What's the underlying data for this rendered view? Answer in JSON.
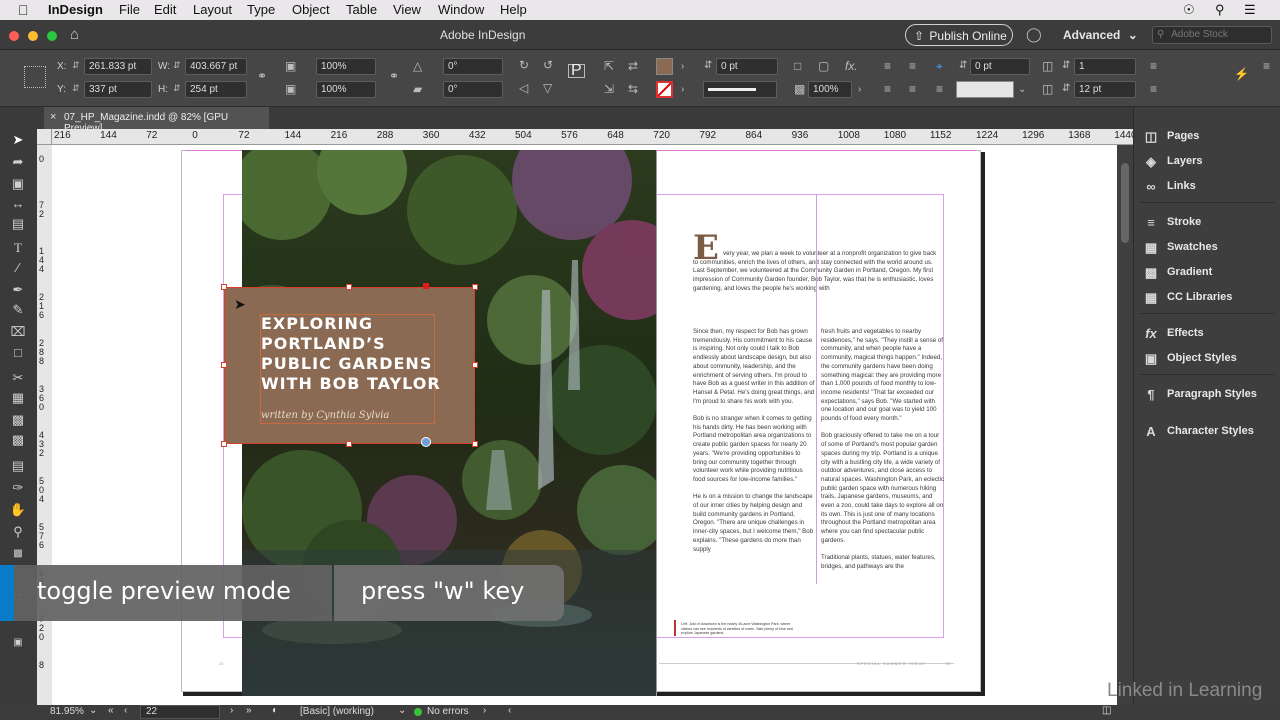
{
  "menubar": {
    "items": [
      "InDesign",
      "File",
      "Edit",
      "Layout",
      "Type",
      "Object",
      "Table",
      "View",
      "Window",
      "Help"
    ]
  },
  "titlebar": {
    "title": "Adobe InDesign",
    "publish_label": "Publish Online",
    "workspace": "Advanced",
    "search_placeholder": "Adobe Stock"
  },
  "control": {
    "x": "261.833 pt",
    "y": "337 pt",
    "w": "403.667 pt",
    "h": "254 pt",
    "x_label": "X:",
    "y_label": "Y:",
    "w_label": "W:",
    "h_label": "H:",
    "scale_x": "100%",
    "scale_y": "100%",
    "rotate": "0°",
    "shear": "0°",
    "stroke_weight": "0 pt",
    "opacity": "100%",
    "offset": "0 pt",
    "columns": "1",
    "gutter": "12 pt",
    "fill_color": "#8b6a54"
  },
  "tab": {
    "title": "07_HP_Magazine.indd @ 82% [GPU Preview]"
  },
  "hruler": [
    "216",
    "144",
    "72",
    "0",
    "72",
    "144",
    "216",
    "288",
    "360",
    "432",
    "504",
    "576",
    "648",
    "720",
    "792",
    "864",
    "936",
    "1008",
    "1080",
    "1152",
    "1224",
    "1296",
    "1368",
    "1440"
  ],
  "vruler": [
    "0",
    "7 2",
    "1 4 4",
    "2 1 6",
    "2 8 8",
    "3 6 0",
    "4 3 2",
    "5 0 4",
    "5 7 6",
    "6 4 8",
    "7 2 0",
    "8"
  ],
  "panels": [
    {
      "label": "Pages",
      "icon": "pages-icon"
    },
    {
      "label": "Layers",
      "icon": "layers-icon"
    },
    {
      "label": "Links",
      "icon": "links-icon"
    },
    {
      "label": "Stroke",
      "icon": "stroke-icon"
    },
    {
      "label": "Swatches",
      "icon": "swatches-icon"
    },
    {
      "label": "Gradient",
      "icon": "gradient-icon"
    },
    {
      "label": "CC Libraries",
      "icon": "cc-libraries-icon"
    },
    {
      "label": "Effects",
      "icon": "effects-icon"
    },
    {
      "label": "Object Styles",
      "icon": "object-styles-icon"
    },
    {
      "label": "Paragraph Styles",
      "icon": "paragraph-styles-icon"
    },
    {
      "label": "Character Styles",
      "icon": "character-styles-icon"
    }
  ],
  "article": {
    "headline": [
      "EXPLORING",
      "PORTLAND’S",
      "PUBLIC GARDENS",
      "WITH BOB TAYLOR"
    ],
    "byline": "written by Cynthia Sylvia",
    "dropcap": "E",
    "intro": "very year, we plan a week to volunteer at a nonprofit organization to give back to communities, enrich the lives of others, and stay connected with the world around us. Last September, we volunteered at the Community Garden in Portland, Oregon. My first impression of Community Garden founder, Bob Taylor, was that he is enthusiastic, loves gardening, and loves the people he's working with",
    "col1": "Since then, my respect for Bob has grown tremendously. His commitment to his cause is inspiring. Not only could I talk to Bob endlessly about landscape design, but also about community, leadership, and the enrichment of serving others. I'm proud to have Bob as a guest writer in this addition of Hansel & Petal. He's doing great things, and I'm proud to share his work with you.\n\nBob is no stranger when it comes to getting his hands dirty. He has been working with Portland metropolitan area organizations to create public garden spaces for nearly 20 years. \"We're providing opportunities to bring our community together through volunteer work while providing nutritious food sources for low-income families.\"\n\nHe is on a mission to change the landscape of our inner cities by helping design and build community gardens in Portland, Oregon. \"There are unique challenges in inner-city spaces, but I welcome them,\" Bob explains. \"These gardens do more than supply",
    "col2": "fresh fruits and vegetables to nearby residences,\" he says. \"They instill a sense of community, and when people have a community, magical things happen.\" Indeed, the community gardens have been doing something magical: they are providing more than 1,000 pounds of food monthly to low-income residents! \"That far exceeded our expectations,\" says Bob. \"We started with one location and our goal was to yield 100 pounds of food every month.\"\n\nBob graciously offered to take me on a tour of some of Portland's most popular garden spaces during my trip. Portland is a unique city with a bustling city life, a wide variety of outdoor adventures, and close access to natural spaces. Washington Park, an eclectic public garden space with numerous hiking trails, Japanese gardens, museums, and even a zoo, could take days to explore all on its own. This is just one of many locations throughout the Portland metropolitan area where you can find spectacular public gardens.\n\nTraditional plants, statues, water features, bridges, and pathways are the",
    "caption": "Left: Just of downtown is the nearly 40-acre Washington Park, where visitors can see hundreds of varieties of roses. Take plenty of time and explore Japanese gardens.",
    "folio_left": "22",
    "folio_right": "23",
    "issue": "SPECIAL SUMMER ISSUE"
  },
  "toast": {
    "left": "toggle preview mode",
    "right": "press \"w\" key"
  },
  "status": {
    "zoom": "81.95%",
    "page": "22",
    "style": "[Basic] (working)",
    "errors": "No errors"
  },
  "watermark": "Linked in Learning"
}
